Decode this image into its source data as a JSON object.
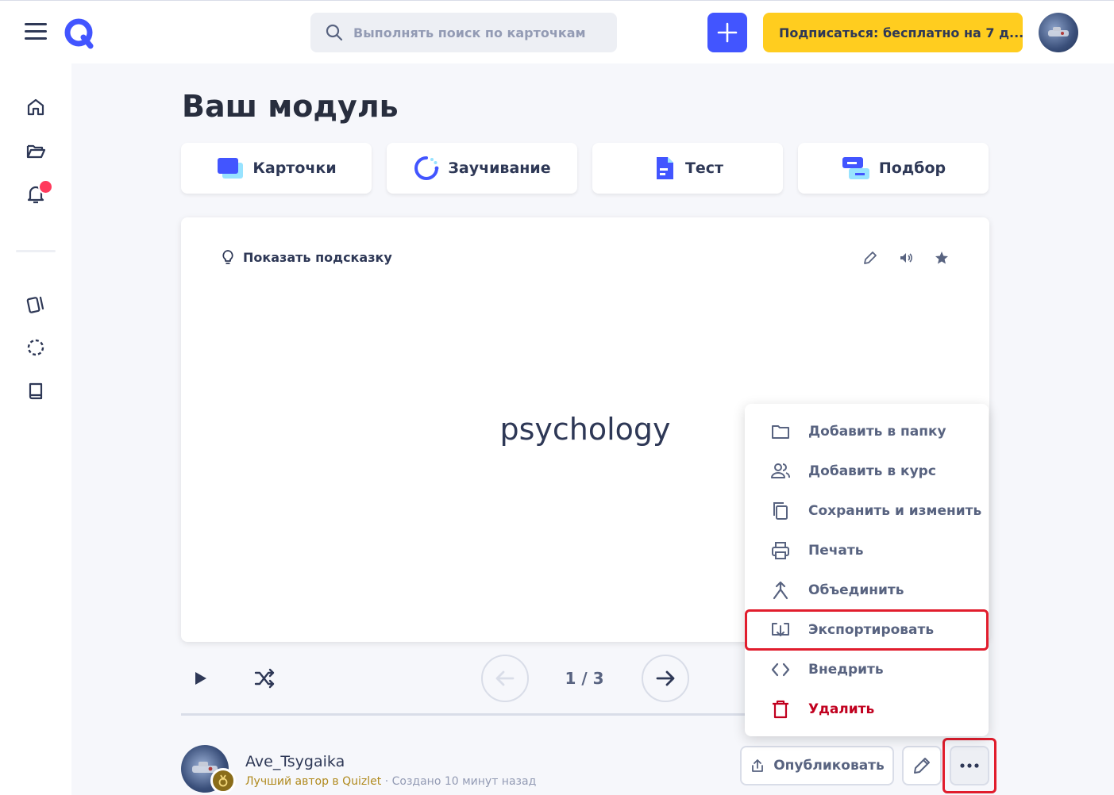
{
  "header": {
    "search_placeholder": "Выполнять поиск по карточкам",
    "subscribe_label": "Подписаться: бесплатно на 7 д..."
  },
  "page": {
    "title": "Ваш модуль"
  },
  "modes": [
    {
      "label": "Карточки",
      "icon": "flashcards-icon"
    },
    {
      "label": "Заучивание",
      "icon": "learn-icon"
    },
    {
      "label": "Тест",
      "icon": "test-icon"
    },
    {
      "label": "Подбор",
      "icon": "match-icon"
    }
  ],
  "card": {
    "hint_label": "Показать подсказку",
    "term": "psychology"
  },
  "controls": {
    "counter": "1 / 3"
  },
  "author": {
    "name": "Ave_Tsygaika",
    "badge": "Лучший автор в Quizlet",
    "separator": "·",
    "created": "Создано 10 минут назад"
  },
  "actions": {
    "publish_label": "Опубликовать"
  },
  "menu": {
    "items": [
      {
        "label": "Добавить в папку",
        "icon": "folder-icon"
      },
      {
        "label": "Добавить в курс",
        "icon": "users-icon"
      },
      {
        "label": "Сохранить и изменить",
        "icon": "copy-icon"
      },
      {
        "label": "Печать",
        "icon": "printer-icon"
      },
      {
        "label": "Объединить",
        "icon": "merge-icon"
      },
      {
        "label": "Экспортировать",
        "icon": "export-icon"
      },
      {
        "label": "Внедрить",
        "icon": "embed-icon"
      },
      {
        "label": "Удалить",
        "icon": "trash-icon"
      }
    ]
  },
  "colors": {
    "accent": "#4255ff",
    "subscribe": "#ffcd1f",
    "danger": "#c1001f",
    "highlight": "#e11d2d",
    "notification": "#ff3a5c"
  }
}
